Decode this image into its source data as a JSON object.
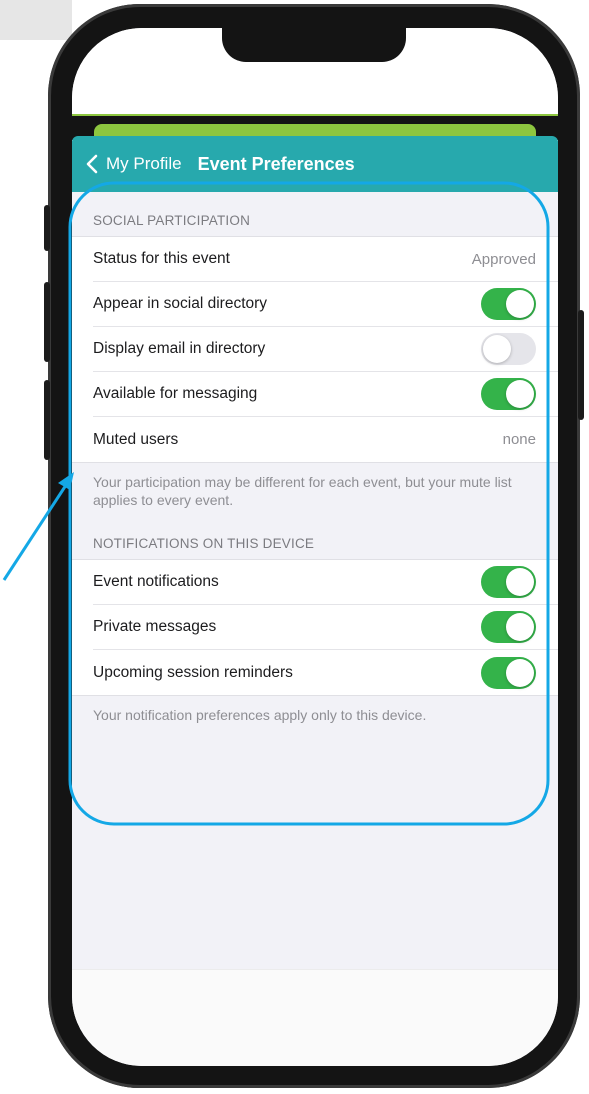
{
  "nav": {
    "back_label": "My Profile",
    "title": "Event Preferences"
  },
  "social": {
    "header": "SOCIAL PARTICIPATION",
    "rows": [
      {
        "label": "Status for this event",
        "value": "Approved"
      },
      {
        "label": "Appear in social directory",
        "toggle": true
      },
      {
        "label": "Display email in directory",
        "toggle": false
      },
      {
        "label": "Available for messaging",
        "toggle": true
      },
      {
        "label": "Muted users",
        "value": "none"
      }
    ],
    "footer": "Your participation may be different for each event, but your mute list applies to every event."
  },
  "notifications": {
    "header": "NOTIFICATIONS ON THIS DEVICE",
    "rows": [
      {
        "label": "Event notifications",
        "toggle": true
      },
      {
        "label": "Private messages",
        "toggle": true
      },
      {
        "label": "Upcoming session reminders",
        "toggle": true
      }
    ],
    "footer": "Your notification preferences apply only to this device."
  },
  "colors": {
    "nav_teal": "#27a9ad",
    "toggle_on": "#34b34a",
    "annotation_blue": "#14a8e6",
    "accent_green": "#8dc63f"
  }
}
